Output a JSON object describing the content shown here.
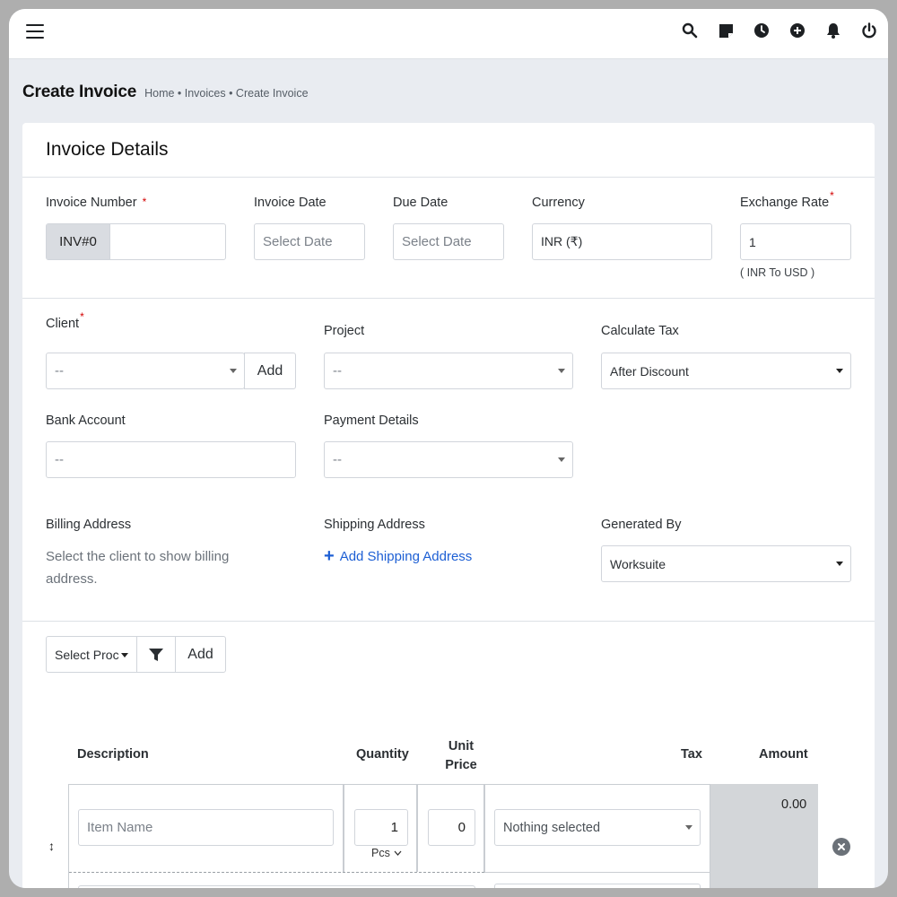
{
  "header": {
    "icons": [
      "search-icon",
      "sticky-note-icon",
      "clock-icon",
      "plus-circle-icon",
      "bell-icon",
      "power-icon"
    ]
  },
  "page": {
    "title": "Create Invoice",
    "breadcrumb": "Home • Invoices • Create Invoice"
  },
  "card": {
    "title": "Invoice Details"
  },
  "invoice": {
    "number_label": "Invoice Number",
    "number_prefix": "INV#0",
    "number_value": "",
    "date_label": "Invoice Date",
    "date_placeholder": "Select Date",
    "due_label": "Due Date",
    "due_placeholder": "Select Date",
    "currency_label": "Currency",
    "currency_value": "INR (₹)",
    "rate_label": "Exchange Rate",
    "rate_value": "1",
    "rate_note": "( INR To USD )"
  },
  "client": {
    "label": "Client",
    "value": "--",
    "add_label": "Add"
  },
  "project": {
    "label": "Project",
    "value": "--"
  },
  "tax_calc": {
    "label": "Calculate Tax",
    "value": "After Discount"
  },
  "bank": {
    "label": "Bank Account",
    "placeholder": "--"
  },
  "payment": {
    "label": "Payment Details",
    "value": "--"
  },
  "billing": {
    "label": "Billing Address",
    "text": "Select the client to show billing address."
  },
  "shipping": {
    "label": "Shipping Address",
    "link": "Add Shipping Address"
  },
  "generated": {
    "label": "Generated By",
    "value": "Worksuite"
  },
  "product": {
    "select_label": "Select Proc",
    "add_label": "Add"
  },
  "table": {
    "headers": {
      "description": "Description",
      "quantity": "Quantity",
      "unit_price": "Unit Price",
      "tax": "Tax",
      "amount": "Amount"
    },
    "row": {
      "item_placeholder": "Item Name",
      "quantity": "1",
      "unit": "Pcs",
      "unit_price": "0",
      "tax": "Nothing selected",
      "amount": "0.00"
    }
  }
}
